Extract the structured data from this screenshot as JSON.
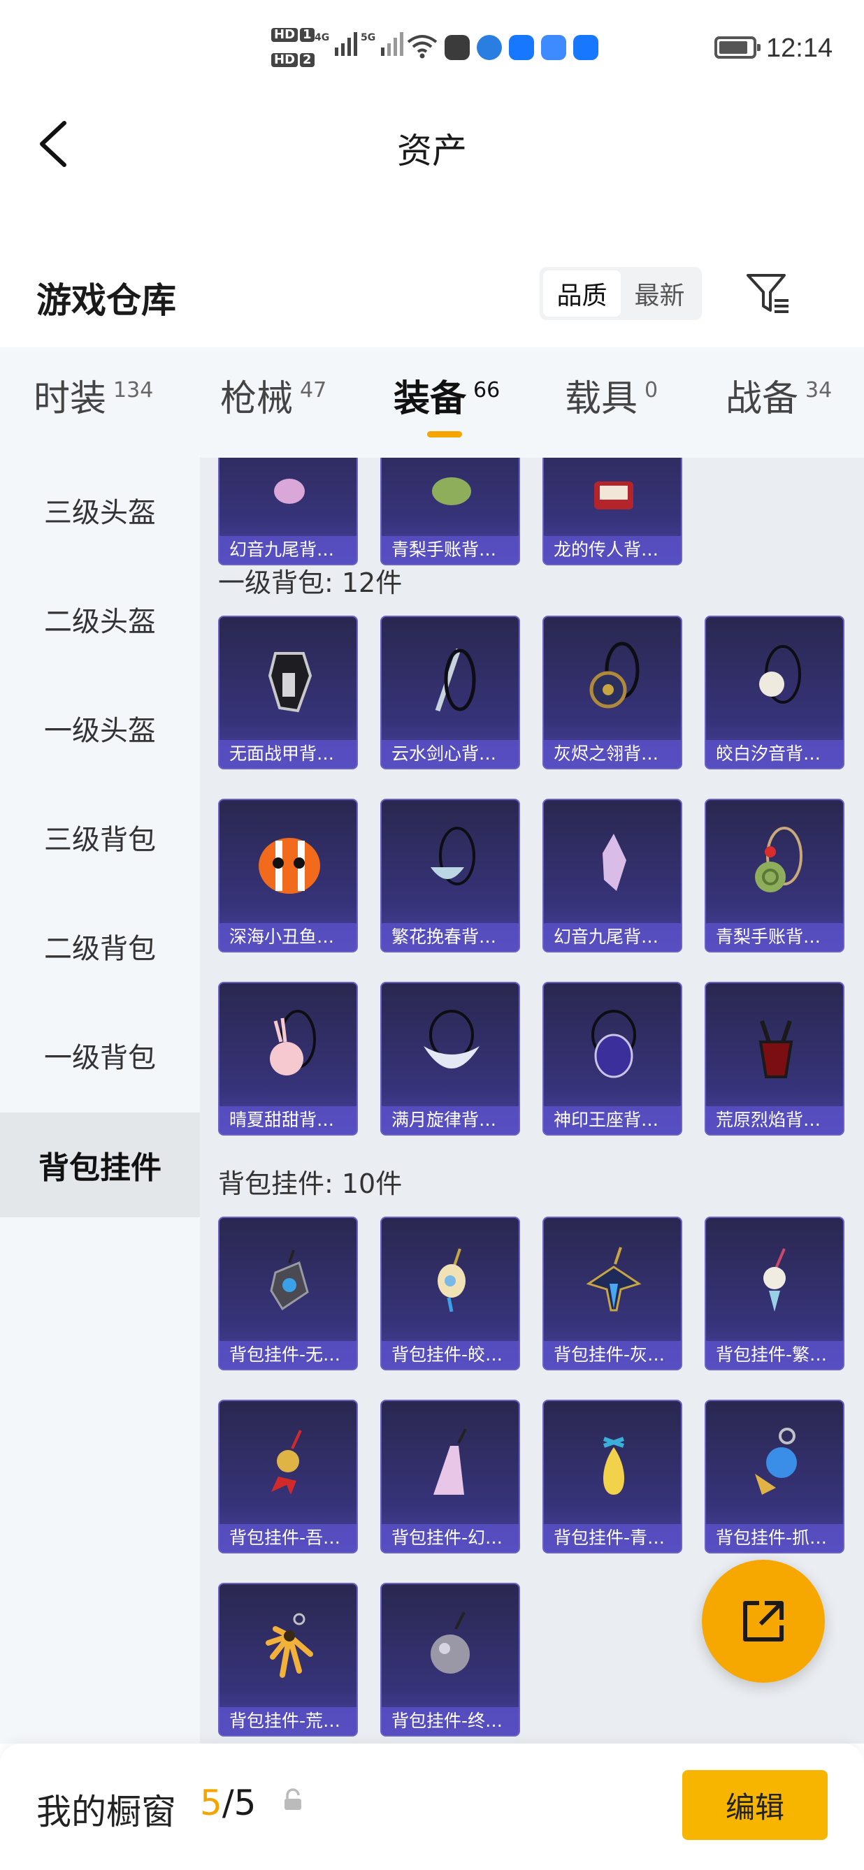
{
  "status_bar": {
    "hd_labels": [
      "HD",
      "1",
      "HD",
      "2"
    ],
    "net_1": "4G",
    "net_2": "5G",
    "wifi_label": "6",
    "time": "12:14"
  },
  "header": {
    "title": "资产"
  },
  "section": {
    "title": "游戏仓库",
    "sort_options": [
      "品质",
      "最新"
    ],
    "active_sort": "品质"
  },
  "tabs": [
    {
      "label": "时装",
      "count": "134"
    },
    {
      "label": "枪械",
      "count": "47"
    },
    {
      "label": "装备",
      "count": "66"
    },
    {
      "label": "载具",
      "count": "0"
    },
    {
      "label": "战备",
      "count": "34"
    }
  ],
  "active_tab": "装备",
  "sidebar": {
    "items": [
      "三级头盔",
      "二级头盔",
      "一级头盔",
      "三级背包",
      "二级背包",
      "一级背包",
      "背包挂件"
    ],
    "active": "背包挂件"
  },
  "groups": {
    "previous_row": [
      "幻音九尾背…",
      "青梨手账背…",
      "龙的传人背…"
    ],
    "level1_bags": {
      "title": "一级背包: 12件",
      "items": [
        "无面战甲背…",
        "云水剑心背…",
        "灰烬之翎背…",
        "皎白汐音背…",
        "深海小丑鱼…",
        "繁花挽春背…",
        "幻音九尾背…",
        "青梨手账背…",
        "晴夏甜甜背…",
        "满月旋律背…",
        "神印王座背…",
        "荒原烈焰背…"
      ]
    },
    "bag_pendants": {
      "title": "背包挂件: 10件",
      "items": [
        "背包挂件-无…",
        "背包挂件-皎…",
        "背包挂件-灰…",
        "背包挂件-繁…",
        "背包挂件-吾…",
        "背包挂件-幻…",
        "背包挂件-青…",
        "背包挂件-抓…",
        "背包挂件-荒…",
        "背包挂件-终…"
      ]
    }
  },
  "bottom_bar": {
    "label": "我的橱窗",
    "count_current": "5",
    "count_sep": "/",
    "count_total": "5",
    "edit_label": "编辑"
  },
  "colors": {
    "accent": "#f5a500",
    "card_top": "#2a2850",
    "card_caption": "#5a50c8",
    "sidebar_bg": "#f4f7fa",
    "content_bg": "#eaedf1"
  }
}
